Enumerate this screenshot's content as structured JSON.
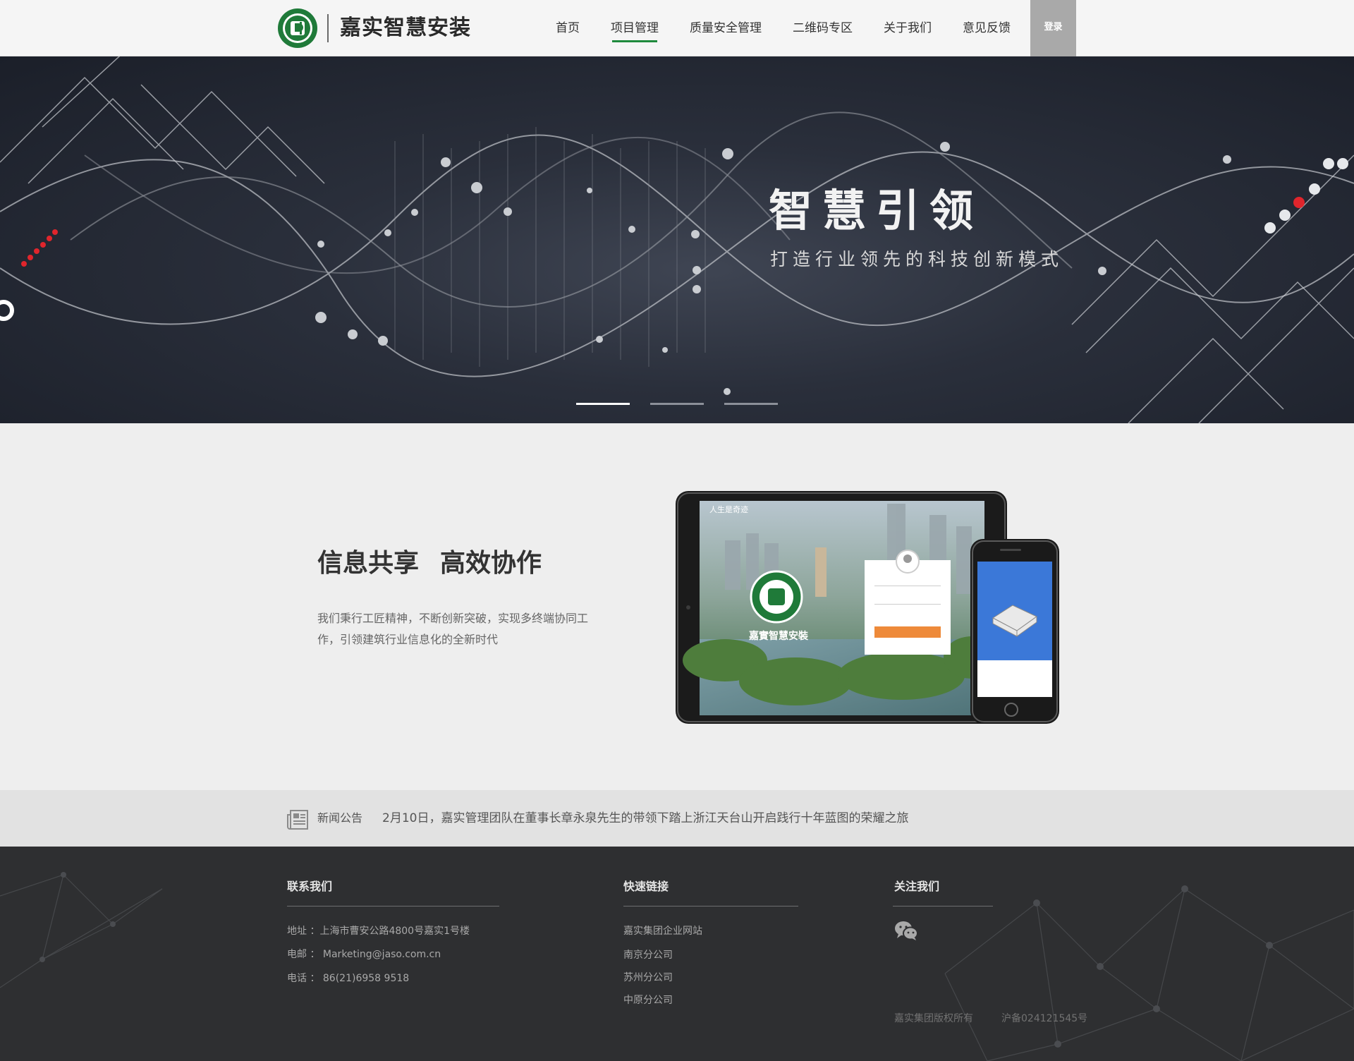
{
  "header": {
    "brand": "嘉实智慧安装",
    "nav": [
      "首页",
      "项目管理",
      "质量安全管理",
      "二维码专区",
      "关于我们",
      "意见反馈"
    ],
    "active_nav": "项目管理",
    "login_label": "登录"
  },
  "banner": {
    "title": "智慧引领",
    "subtitle": "打造行业领先的科技创新模式",
    "slides_count": 3,
    "active_slide": 1
  },
  "feature": {
    "title_part1": "信息共享",
    "title_part2": "高效协作",
    "description": "我们秉行工匠精神，不断创新突破，实现多终端协同工作，引领建筑行业信息化的全新时代",
    "tablet_brand": "嘉實智慧安裝",
    "tablet_slogan": "人生是奇迹"
  },
  "news": {
    "label": "新闻公告",
    "headline": "2月10日，嘉实管理团队在董事长章永泉先生的带领下踏上浙江天台山开启践行十年蓝图的荣耀之旅"
  },
  "footer": {
    "contact": {
      "heading": "联系我们",
      "address": "地址 ：上海市曹安公路4800号嘉实1号楼",
      "email": "电邮 ： Marketing@jaso.com.cn",
      "phone": "电话 ： 86(21)6958 9518"
    },
    "links": {
      "heading": "快速链接",
      "items": [
        "嘉实集团企业网站",
        "南京分公司",
        "苏州分公司",
        "中原分公司"
      ]
    },
    "follow": {
      "heading": "关注我们",
      "icon": "wechat-icon"
    },
    "copyright": "嘉实集团版权所有",
    "icp": "沪备024121545号"
  },
  "colors": {
    "accent_green": "#1f8a3d",
    "login_bg": "#a9a9a9",
    "footer_bg": "#2e2f31",
    "banner_bg": "#1f2430",
    "red_dot": "#e0252c"
  }
}
